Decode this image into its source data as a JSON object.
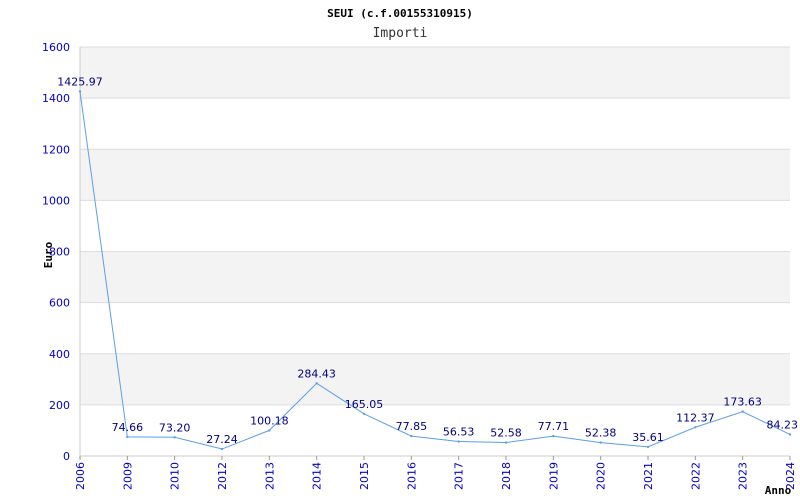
{
  "chart_data": {
    "type": "line",
    "title": "SEUI (c.f.00155310915)",
    "subtitle": "Importi",
    "xlabel": "Anno",
    "ylabel": "Euro",
    "ylim": [
      0,
      1600
    ],
    "yticks": [
      "0",
      "200",
      "400",
      "600",
      "800",
      "1000",
      "1200",
      "1400",
      "1600"
    ],
    "categories": [
      "2006",
      "2009",
      "2010",
      "2012",
      "2013",
      "2014",
      "2015",
      "2016",
      "2017",
      "2018",
      "2019",
      "2020",
      "2021",
      "2022",
      "2023",
      "2024"
    ],
    "values": [
      1425.97,
      74.66,
      73.2,
      27.24,
      100.18,
      284.43,
      165.05,
      77.85,
      56.53,
      52.58,
      77.71,
      52.38,
      35.61,
      112.37,
      173.63,
      84.23
    ],
    "value_labels": [
      "1425.97",
      "74.66",
      "73.20",
      "27.24",
      "100.18",
      "284.43",
      "165.05",
      "77.85",
      "56.53",
      "52.58",
      "77.71",
      "52.38",
      "35.61",
      "112.37",
      "173.63",
      "84.23"
    ],
    "grid": true,
    "colors": {
      "line": "#5aa0e6",
      "band": "#f3f3f3",
      "grid": "#dddddd",
      "tick_text": "#0000cc",
      "label_text": "#000080"
    }
  }
}
